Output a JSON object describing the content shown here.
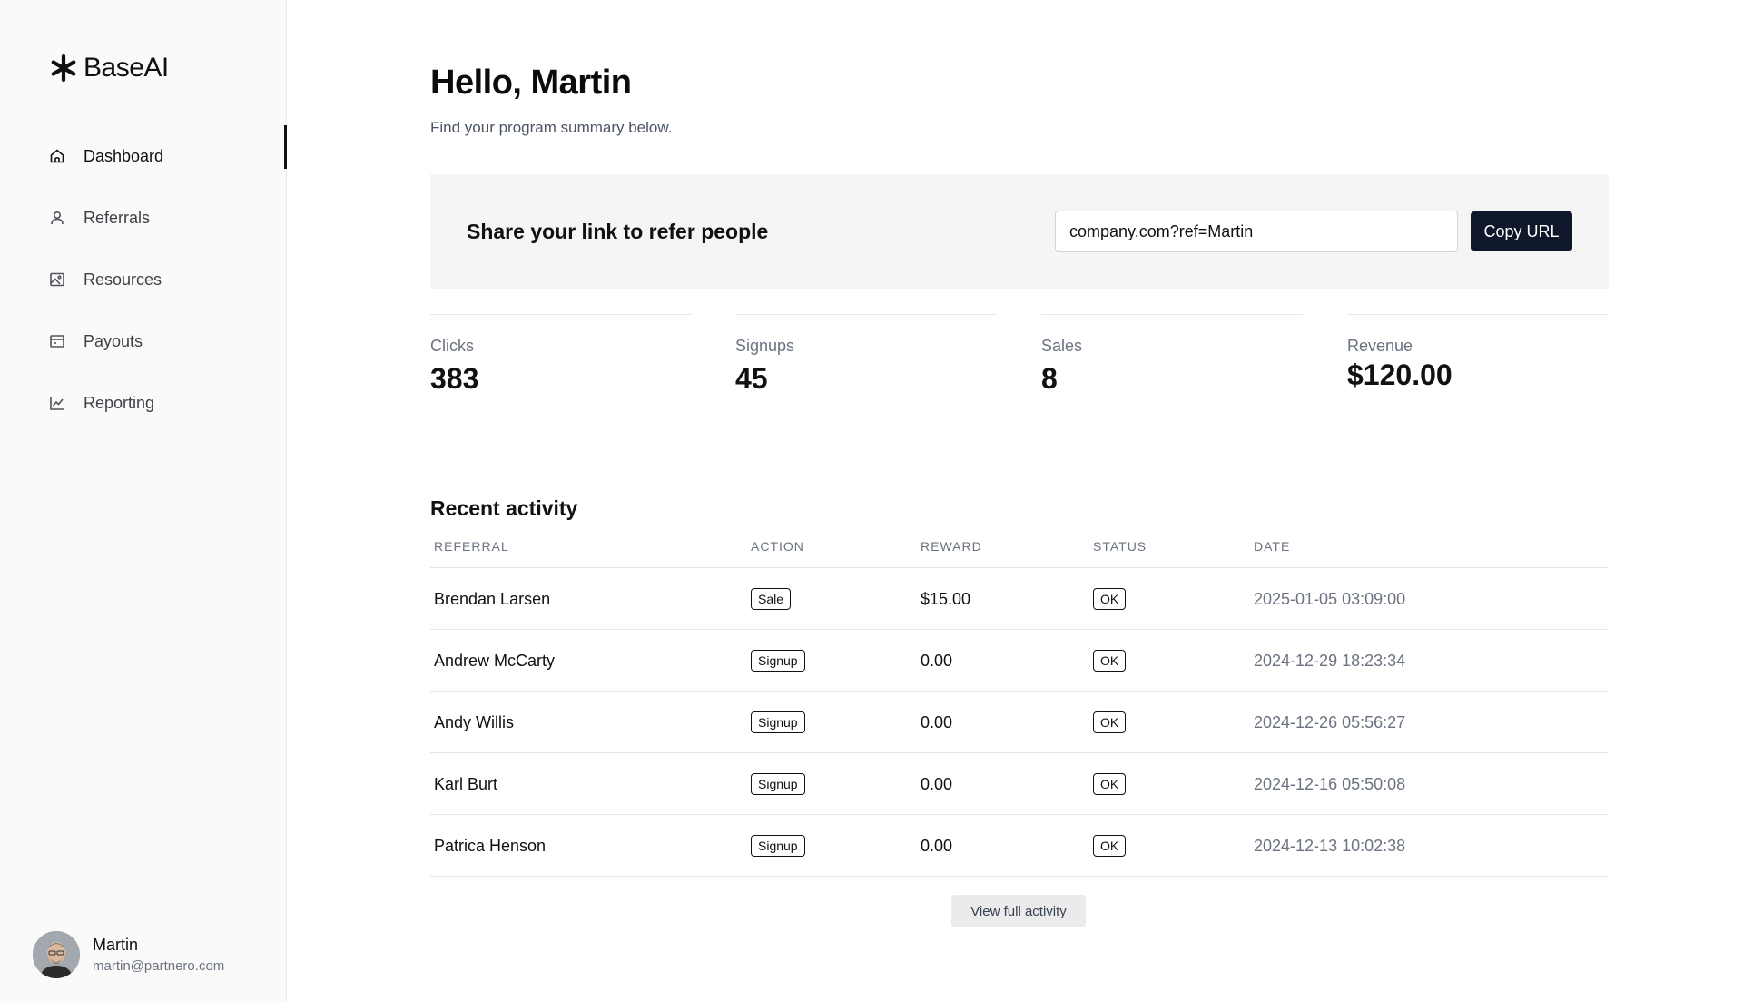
{
  "brand": {
    "name": "BaseAI",
    "icon": "asterisk-logo-icon"
  },
  "sidebar": {
    "items": [
      {
        "label": "Dashboard",
        "icon": "home-icon",
        "active": true
      },
      {
        "label": "Referrals",
        "icon": "user-icon",
        "active": false
      },
      {
        "label": "Resources",
        "icon": "image-icon",
        "active": false
      },
      {
        "label": "Payouts",
        "icon": "wallet-icon",
        "active": false
      },
      {
        "label": "Reporting",
        "icon": "line-chart-icon",
        "active": false
      }
    ]
  },
  "user": {
    "name": "Martin",
    "email": "martin@partnero.com"
  },
  "header": {
    "greeting": "Hello, Martin",
    "subtitle": "Find your program summary below."
  },
  "share": {
    "title": "Share your link to refer people",
    "url_value": "company.com?ref=Martin",
    "copy_label": "Copy URL"
  },
  "stats": [
    {
      "label": "Clicks",
      "value": "383"
    },
    {
      "label": "Signups",
      "value": "45"
    },
    {
      "label": "Sales",
      "value": "8"
    },
    {
      "label": "Revenue",
      "value": "$120.00"
    }
  ],
  "activity": {
    "title": "Recent activity",
    "columns": [
      "Referral",
      "Action",
      "Reward",
      "Status",
      "Date"
    ],
    "rows": [
      {
        "referral": "Brendan Larsen",
        "action": "Sale",
        "reward": "$15.00",
        "status": "OK",
        "date": "2025-01-05 03:09:00"
      },
      {
        "referral": "Andrew McCarty",
        "action": "Signup",
        "reward": "0.00",
        "status": "OK",
        "date": "2024-12-29 18:23:34"
      },
      {
        "referral": "Andy Willis",
        "action": "Signup",
        "reward": "0.00",
        "status": "OK",
        "date": "2024-12-26 05:56:27"
      },
      {
        "referral": "Karl Burt",
        "action": "Signup",
        "reward": "0.00",
        "status": "OK",
        "date": "2024-12-16 05:50:08"
      },
      {
        "referral": "Patrica Henson",
        "action": "Signup",
        "reward": "0.00",
        "status": "OK",
        "date": "2024-12-13 10:02:38"
      }
    ],
    "view_all_label": "View full activity"
  },
  "colors": {
    "accent": "#0f172a",
    "sidebar_bg": "#fafafa",
    "panel_bg": "#f5f5f5"
  }
}
